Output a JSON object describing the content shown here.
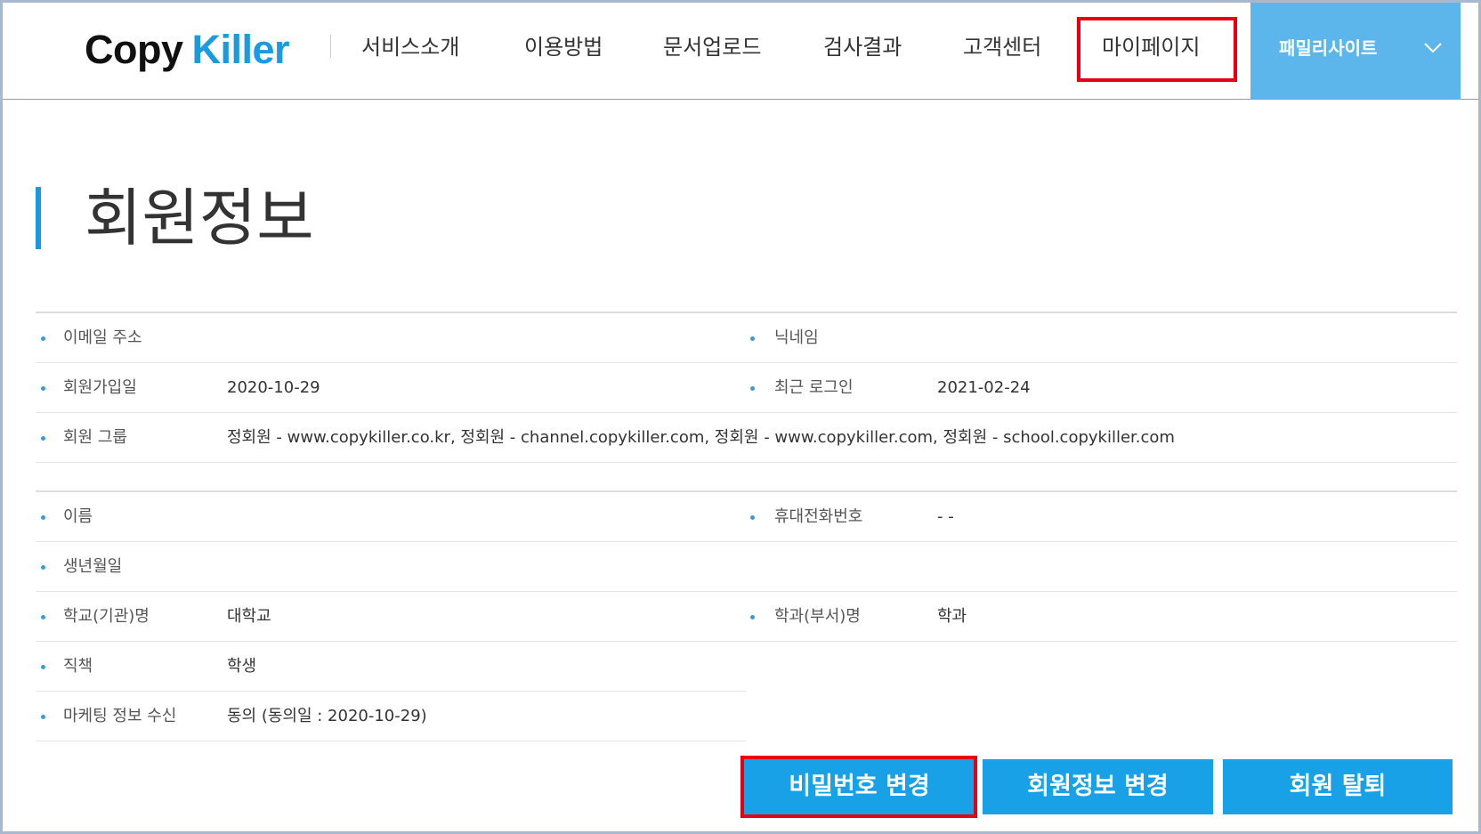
{
  "colors": {
    "accent": "#1a9be0",
    "button": "#18a1e6",
    "family_bg": "#5cb6ec",
    "highlight": "#e60012",
    "text": "#333333"
  },
  "header": {
    "logo": {
      "part1": "Copy",
      "part2": "Killer"
    },
    "nav": [
      {
        "label": "서비스소개"
      },
      {
        "label": "이용방법"
      },
      {
        "label": "문서업로드"
      },
      {
        "label": "검사결과"
      },
      {
        "label": "고객센터"
      },
      {
        "label": "마이페이지",
        "highlighted": true
      }
    ],
    "family_site": {
      "label": "패밀리사이트",
      "icon": "chevron-down-icon"
    }
  },
  "page_title": "회원정보",
  "account_info": {
    "rows": [
      {
        "left": {
          "label": "이메일 주소"
        },
        "right": {
          "label": "닉네임"
        }
      },
      {
        "left": {
          "label": "회원가입일",
          "value": "2020-10-29"
        },
        "right": {
          "label": "최근 로그인",
          "value": "2021-02-24"
        }
      },
      {
        "full": {
          "label": "회원 그룹",
          "value": "정회원 - www.copykiller.co.kr, 정회원 - channel.copykiller.com, 정회원 - www.copykiller.com, 정회원 - school.copykiller.com"
        }
      }
    ]
  },
  "personal_info": {
    "rows": [
      {
        "left": {
          "label": "이름"
        },
        "right": {
          "label": "휴대전화번호",
          "value": "- -"
        }
      },
      {
        "left": {
          "label": "생년월일"
        }
      },
      {
        "left": {
          "label": "학교(기관)명",
          "value": "대학교"
        },
        "right": {
          "label": "학과(부서)명",
          "value": "학과"
        }
      },
      {
        "left": {
          "label": "직책",
          "value": "학생"
        }
      },
      {
        "left": {
          "label": "마케팅 정보 수신",
          "value": "동의 (동의일 : 2020-10-29)"
        }
      }
    ]
  },
  "actions": [
    {
      "label": "비밀번호 변경",
      "highlighted": true
    },
    {
      "label": "회원정보 변경"
    },
    {
      "label": "회원 탈퇴"
    }
  ]
}
